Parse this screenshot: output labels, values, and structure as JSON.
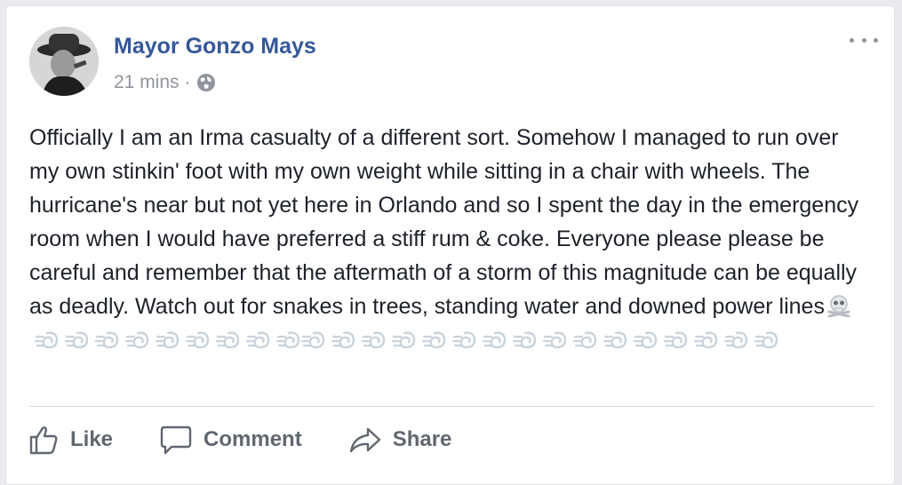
{
  "post": {
    "author": "Mayor Gonzo Mays",
    "timestamp": "21 mins",
    "separator": "·",
    "privacy_icon": "globe-icon",
    "text": "Officially I am an Irma casualty of a different sort. Somehow I managed to run over my own stinkin' foot with my own weight while sitting in a chair with wheels. The hurricane's near but not yet here in Orlando and so I spent the day in the emergency room when I would have preferred a stiff rum & coke. Everyone please please be careful and remember that the aftermath of a storm of this magnitude can be equally as deadly. Watch out for snakes in trees, standing water and downed power lines",
    "emojis": {
      "skull": "skull-crossbones-icon",
      "dashing_away_count": 25,
      "dashing_away": "dashing-away-icon"
    }
  },
  "actions": {
    "like_label": "Like",
    "comment_label": "Comment",
    "share_label": "Share"
  },
  "colors": {
    "author_link": "#365899",
    "meta_text": "#90949c",
    "body_text": "#1d2129",
    "action_text": "#616770"
  }
}
